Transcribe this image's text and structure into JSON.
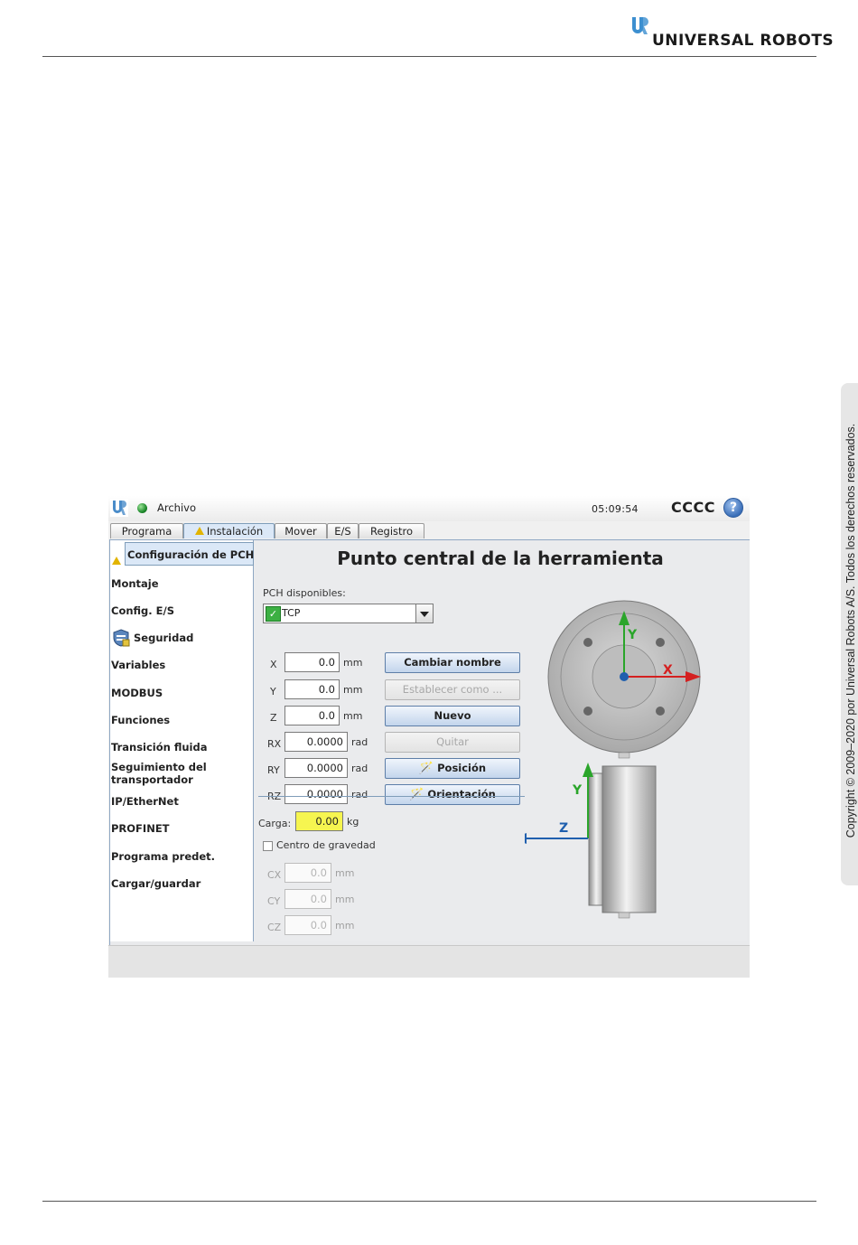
{
  "page": {
    "brand": "UNIVERSAL ROBOTS",
    "copyright": "Copyright © 2009–2020 por Universal Robots A/S. Todos los derechos reservados."
  },
  "app": {
    "menu_file": "Archivo",
    "clock": "05:09:54",
    "robot_name": "CCCC",
    "help_symbol": "?",
    "status_color": "#2b9a3a"
  },
  "tabs": [
    {
      "label": "Programa",
      "active": false
    },
    {
      "label": "Instalación",
      "active": true,
      "warning": true
    },
    {
      "label": "Mover",
      "active": false
    },
    {
      "label": "E/S",
      "active": false
    },
    {
      "label": "Registro",
      "active": false
    }
  ],
  "sidebar": {
    "items": [
      {
        "label": "Configuración de PCH",
        "selected": true,
        "icon": "warning-icon"
      },
      {
        "label": "Montaje"
      },
      {
        "label": "Config. E/S"
      },
      {
        "label": "Seguridad",
        "icon": "safety-shield-icon"
      },
      {
        "label": "Variables"
      },
      {
        "label": "MODBUS"
      },
      {
        "label": "Funciones"
      },
      {
        "label": "Transición fluida"
      },
      {
        "label": "Seguimiento del\ntransportador"
      },
      {
        "label": "IP/EtherNet"
      },
      {
        "label": "PROFINET"
      },
      {
        "label": "Programa predet."
      },
      {
        "label": "Cargar/guardar"
      }
    ]
  },
  "tcp": {
    "title": "Punto central de la herramienta",
    "available_label": "PCH disponibles:",
    "selected_tcp": "TCP",
    "fields": [
      {
        "label": "X",
        "value": "0.0",
        "unit": "mm"
      },
      {
        "label": "Y",
        "value": "0.0",
        "unit": "mm"
      },
      {
        "label": "Z",
        "value": "0.0",
        "unit": "mm"
      },
      {
        "label": "RX",
        "value": "0.0000",
        "unit": "rad"
      },
      {
        "label": "RY",
        "value": "0.0000",
        "unit": "rad"
      },
      {
        "label": "RZ",
        "value": "0.0000",
        "unit": "rad"
      }
    ],
    "buttons": {
      "rename": "Cambiar nombre",
      "set_default": "Establecer como ...",
      "new": "Nuevo",
      "remove": "Quitar",
      "position": "Posición",
      "orientation": "Orientación"
    },
    "payload_label": "Carga:",
    "payload_value": "0.00",
    "payload_unit": "kg",
    "cog_label": "Centro de gravedad",
    "cog_fields": [
      {
        "label": "CX",
        "value": "0.0",
        "unit": "mm"
      },
      {
        "label": "CY",
        "value": "0.0",
        "unit": "mm"
      },
      {
        "label": "CZ",
        "value": "0.0",
        "unit": "mm"
      }
    ],
    "axes": {
      "x": "X",
      "y": "Y",
      "z": "Z",
      "x_color": "#d42020",
      "y_color": "#2aa52a",
      "z_color": "#1f5fae"
    }
  }
}
